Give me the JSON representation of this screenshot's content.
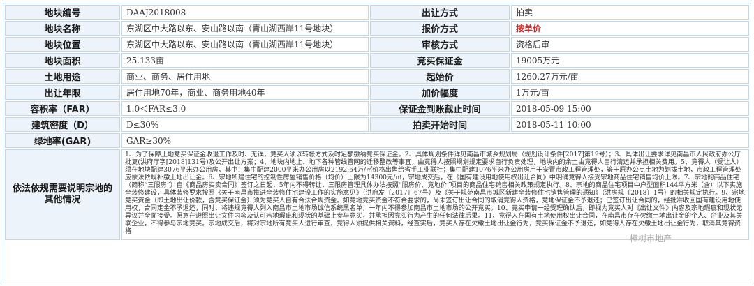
{
  "rows": [
    {
      "l1": "地块编号",
      "v1": "DAAJ2018008",
      "l2": "出让方式",
      "v2": "拍卖"
    },
    {
      "l1": "地块名称",
      "v1": "东湖区中大路以东、安山路以南（青山湖西岸11号地块）",
      "l2": "报价方式",
      "v2": "按单价"
    },
    {
      "l1": "地块位置",
      "v1": "东湖区中大路以东、安山路以南（青山湖西岸11号地块）",
      "l2": "审核方式",
      "v2": "资格后审"
    },
    {
      "l1": "地块面积",
      "v1": "25.133亩",
      "l2": "竞买保证金",
      "v2": "19005万元"
    },
    {
      "l1": "土地用途",
      "v1": "商业、商务、居住用地",
      "l2": "起始价",
      "v2": "1260.27万元/亩"
    },
    {
      "l1": "出让年限",
      "v1": "居住用地70年，商业、商务用地40年",
      "l2": "加价幅度",
      "v2": "1万元/亩"
    },
    {
      "l1": "容积率（FAR）",
      "v1": "1.0＜FAR≤3.0",
      "l2": "保证金到账截止时间",
      "v2": "2018-05-09 15:00"
    },
    {
      "l1": "建筑密度（D）",
      "v1": "D≤30%",
      "l2": "拍卖开始时间",
      "v2": "2018-05-11 10:00"
    }
  ],
  "green_label": "绿地率(GAR)",
  "green_value": "GAR≥30%",
  "notes_label": "依法依规需要说明宗地的其他情况",
  "notes_text": "1、为了保障土地竞买保证金收退工作及时、无误，竞买人须以转帐方式及时足额缴纳竞买保证金。2、具体规划条件详见南昌市城乡规划局（规划设计条件[2017]第19号）；3、具体出让要求详见南昌市人民政府办公厅批复(洪府厅字[2018]131号)及公开出让方案；4、地块内地上、地下各种管线管网的迁移整改等事宜，由竞得人按照规划规定要求自行负责处理，地块内的余土由竞得人自行清运并承担相关费用。5、竞得人（受让人）须在地块配建3076平米办公用房，其中：集中配建2000平米办公用房以2192.64万/㎡价格出售给省手工业联社；集中配建1076平米办公用房用于安置市政工程管理处，鉴于原办公点土地为划拨土地，市政工程管理处应依法依规补缴土地出让金。6、宗地所建住宅的控制性房屋销售价格（均价）上限为14300元/㎡，宗地成交后，在《国有建设用地使用权出让合同》中明确竞得人接受宗地商品住宅销售均价上限。7、宗地的商品住宅（简称“三限房”）自《商品房买卖合同》签订之日起，5年内不得转让，三限房管理具体办法按照“限房价、竞地价”项目的商品住宅销售相关政策规定执行。8、宗地的商品住宅项目中户型面积144平方米（含）以下实施全装修建设，具体装修要求按照《关于南昌市推进全装修住宅建设工作的实施意见》（洪府发〔2017〕67号）及《关于规范南昌市城区新建全装修住宅销售管理的通知》（洪房规〔2018〕1号）的相关规定执行。9、宗地竞买资金（即土地出让价款，含竞买保证金）须为竞买人自有合法合规资金。如竞地竞买资金不符合要求的，尚未签订出让合同的取消竞得人资格，竞地保证金不予退还；已签订出让合同的，经批准收回国有建设用地使用权，合同定金不予退还，同时，将违规竞得人列入南昌市土地市场诚信系统黑名单，一年内不得参加南昌市土地市场的公开竞买。10、竞买申请一经受理确认后，即视为竞买人对《出让文件》内容及宗地瑕疵和现状无异议并全面接受。愿意在遵照出让文件内容及认可宗地瑕疵和现状的基础上参与竞买，并承担因竞买行为产生的任何法律后果。11、竞得人在国有土地使用权出让合同，在南昌市存在欠缴土地出让金的个人、企业及其关联企业，不得参与宗地竞买。宗地成交后，将对宗地所有竞买人进行审查，竞得人须提供相关资料，经查实后，竞买人存在欠缴土地出让金行为，竞买保证金不予退还，如竞得人存在欠缴土地出让金行为，取消其竞得资格",
  "watermark": "樟树市地产"
}
